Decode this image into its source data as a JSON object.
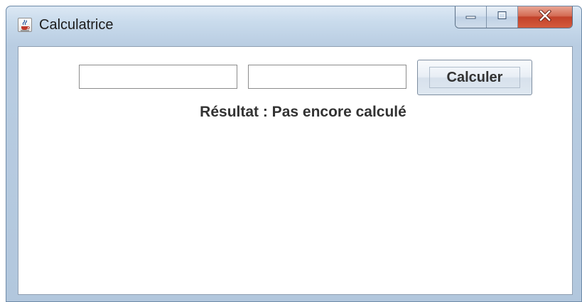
{
  "window": {
    "title": "Calculatrice",
    "app_icon": "java-cup-icon",
    "controls": {
      "minimize_icon": "minimize-icon",
      "maximize_icon": "maximize-icon",
      "close_icon": "close-icon"
    }
  },
  "form": {
    "field1": {
      "value": "",
      "placeholder": ""
    },
    "field2": {
      "value": "",
      "placeholder": ""
    },
    "calculate_label": "Calculer",
    "result_text": "Résultat : Pas encore calculé"
  },
  "colors": {
    "close_button": "#c2422a",
    "title_bar": "#c9dbec",
    "text": "#333333"
  }
}
